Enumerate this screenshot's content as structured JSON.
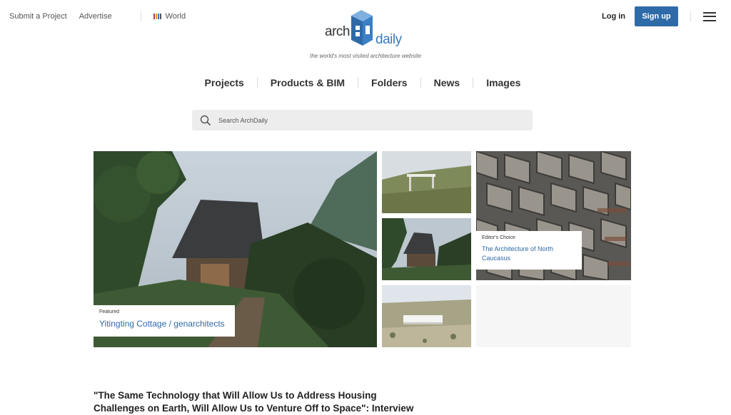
{
  "header": {
    "submit_project": "Submit a Project",
    "advertise": "Advertise",
    "region": "World",
    "login": "Log in",
    "signup": "Sign up",
    "logo_left": "arch",
    "logo_right": "daily",
    "tagline": "the world's most visited architecture website",
    "brand_color": "#2e6aa8"
  },
  "nav": {
    "items": [
      "Projects",
      "Products & BIM",
      "Folders",
      "News",
      "Images"
    ]
  },
  "search": {
    "placeholder": "Search ArchDaily"
  },
  "featured": {
    "kicker": "Featured",
    "title": "Yitingting Cottage / genarchitects"
  },
  "editors_choice": {
    "kicker": "Editor's Choice",
    "title": "The Architecture of North Caucasus"
  },
  "article": {
    "headline": "\"The Same Technology that Will Allow Us to Address Housing Challenges on Earth, Will Allow Us to Venture Off to Space\": Interview with Jason"
  }
}
